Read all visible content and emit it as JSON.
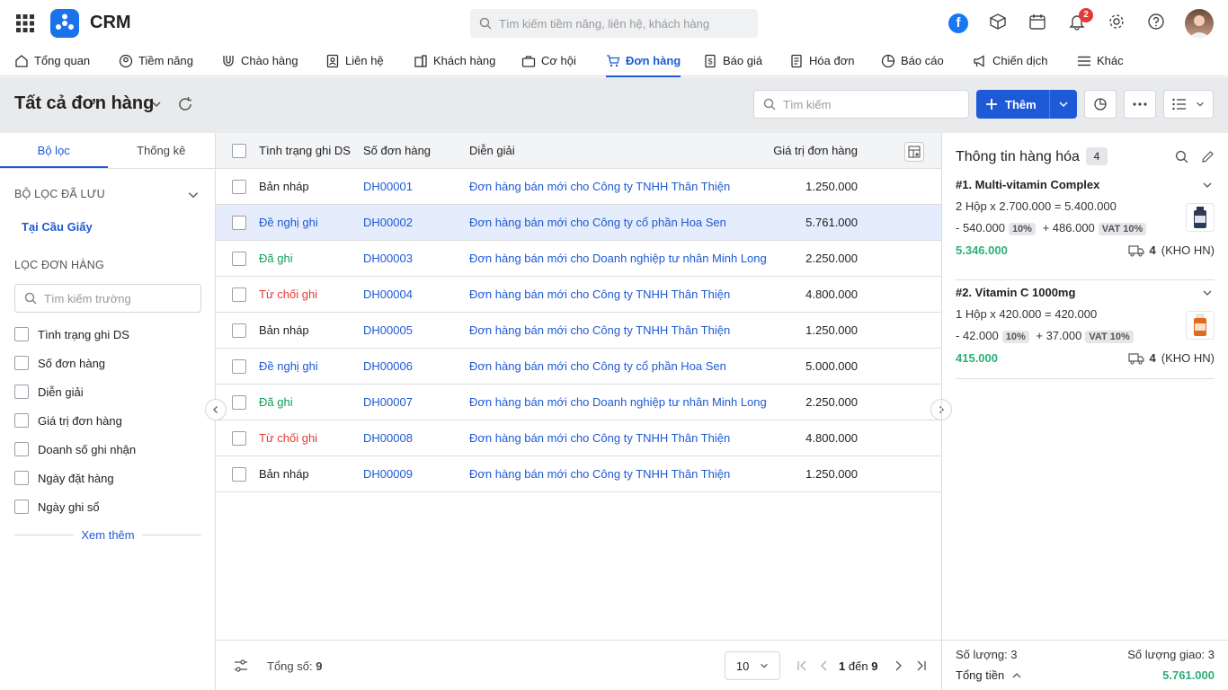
{
  "app": {
    "brand": "CRM",
    "search_placeholder": "Tìm kiếm tiềm năng, liên hệ, khách hàng",
    "notification_count": "2",
    "facebook_letter": "f"
  },
  "nav": [
    {
      "label": "Tổng quan",
      "icon": "home-icon"
    },
    {
      "label": "Tiềm năng",
      "icon": "target-icon"
    },
    {
      "label": "Chào hàng",
      "icon": "magnet-icon"
    },
    {
      "label": "Liên hệ",
      "icon": "contact-icon"
    },
    {
      "label": "Khách hàng",
      "icon": "building-icon"
    },
    {
      "label": "Cơ hội",
      "icon": "briefcase-icon"
    },
    {
      "label": "Đơn hàng",
      "icon": "cart-icon"
    },
    {
      "label": "Báo giá",
      "icon": "quote-icon"
    },
    {
      "label": "Hóa đơn",
      "icon": "invoice-icon"
    },
    {
      "label": "Báo cáo",
      "icon": "pie-chart-icon"
    },
    {
      "label": "Chiến dịch",
      "icon": "megaphone-icon"
    },
    {
      "label": "Khác",
      "icon": "menu-icon"
    }
  ],
  "header": {
    "title": "Tất cả đơn hàng",
    "search_placeholder": "Tìm kiếm",
    "add_label": "Thêm"
  },
  "filter": {
    "tabs": [
      "Bộ lọc",
      "Thống kê"
    ],
    "saved_title": "BỘ LỌC ĐÃ LƯU",
    "saved_item": "Tại Cầu Giấy",
    "order_filter_title": "LỌC ĐƠN HÀNG",
    "field_search_placeholder": "Tìm kiếm trường",
    "fields": [
      "Tình trạng ghi DS",
      "Số đơn hàng",
      "Diễn giải",
      "Giá trị đơn hàng",
      "Doanh số ghi nhận",
      "Ngày đặt hàng",
      "Ngày ghi sổ"
    ],
    "more_label": "Xem thêm"
  },
  "table": {
    "headers": {
      "status": "Tình trạng ghi DS",
      "number": "Số đơn hàng",
      "desc": "Diễn giải",
      "value": "Giá trị đơn hàng"
    },
    "rows": [
      {
        "status": "Bản nháp",
        "status_type": "draft",
        "number": "DH00001",
        "desc": "Đơn hàng bán mới cho Công ty TNHH Thân Thiện",
        "value": "1.250.000"
      },
      {
        "status": "Đề nghị ghi",
        "status_type": "prop",
        "number": "DH00002",
        "desc": "Đơn hàng bán mới cho Công ty cổ phần Hoa Sen",
        "value": "5.761.000",
        "selected": true
      },
      {
        "status": "Đã ghi",
        "status_type": "ok",
        "number": "DH00003",
        "desc": "Đơn hàng bán mới cho Doanh nghiệp tư nhân Minh Long",
        "value": "2.250.000"
      },
      {
        "status": "Từ chối ghi",
        "status_type": "rej",
        "number": "DH00004",
        "desc": "Đơn hàng bán mới cho Công ty TNHH Thân Thiện",
        "value": "4.800.000"
      },
      {
        "status": "Bản nháp",
        "status_type": "draft",
        "number": "DH00005",
        "desc": "Đơn hàng bán mới cho Công ty TNHH Thân Thiện",
        "value": "1.250.000"
      },
      {
        "status": "Đề nghị ghi",
        "status_type": "prop",
        "number": "DH00006",
        "desc": "Đơn hàng bán mới cho Công ty cổ phần Hoa Sen",
        "value": "5.000.000"
      },
      {
        "status": "Đã ghi",
        "status_type": "ok",
        "number": "DH00007",
        "desc": "Đơn hàng bán mới cho Doanh nghiệp tư nhân Minh Long",
        "value": "2.250.000"
      },
      {
        "status": "Từ chối ghi",
        "status_type": "rej",
        "number": "DH00008",
        "desc": "Đơn hàng bán mới cho Công ty TNHH Thân Thiện",
        "value": "4.800.000"
      },
      {
        "status": "Bản nháp",
        "status_type": "draft",
        "number": "DH00009",
        "desc": "Đơn hàng bán mới cho Công ty TNHH Thân Thiện",
        "value": "1.250.000"
      }
    ],
    "footer": {
      "total_label": "Tổng số:",
      "total_value": "9",
      "page_size": "10",
      "page_from": "1",
      "page_to_label": "đến",
      "page_to": "9"
    }
  },
  "detail": {
    "title": "Thông tin hàng hóa",
    "count": "4",
    "products": [
      {
        "name": "#1. Multi-vitamin Complex",
        "qty_line": "2 Hộp x 2.700.000 = 5.400.000",
        "discount": "- 540.000",
        "discount_pct": "10%",
        "vat_amount": "+ 486.000",
        "vat_label": "VAT 10%",
        "total": "5.346.000",
        "stock": "4",
        "warehouse": "(KHO HN)"
      },
      {
        "name": "#2. Vitamin C 1000mg",
        "qty_line": "1 Hộp x 420.000 = 420.000",
        "discount": "- 42.000",
        "discount_pct": "10%",
        "vat_amount": "+ 37.000",
        "vat_label": "VAT 10%",
        "total": "415.000",
        "stock": "4",
        "warehouse": "(KHO HN)"
      }
    ],
    "footer": {
      "qty_label": "Số lượng: 3",
      "delivered_label": "Số lượng giao: 3",
      "total_label": "Tổng tiền",
      "total_value": "5.761.000"
    }
  },
  "colors": {
    "accent": "#1e5ad6",
    "success": "#0d9f5c",
    "danger": "#e53935",
    "total_green": "#2bb07a"
  }
}
